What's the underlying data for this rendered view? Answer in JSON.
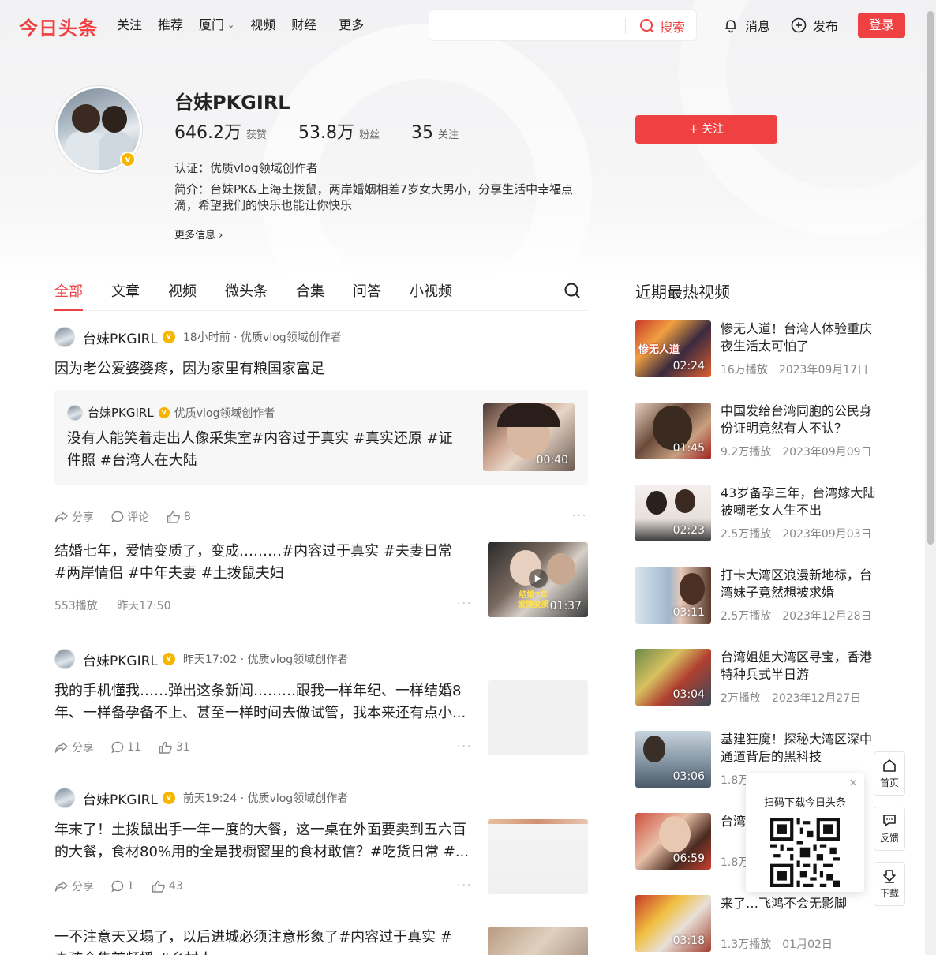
{
  "header": {
    "logo": "今日头条",
    "nav": [
      "关注",
      "推荐",
      "厦门",
      "视频",
      "财经",
      "更多"
    ],
    "search_placeholder": "",
    "search_label": "搜索",
    "messages": "消息",
    "publish": "发布",
    "login": "登录"
  },
  "profile": {
    "name": "台妹PKGIRL",
    "likes_num": "646.2万",
    "likes_label": "获赞",
    "fans_num": "53.8万",
    "fans_label": "粉丝",
    "following_num": "35",
    "following_label": "关注",
    "follow_button": "+ 关注",
    "certification": "认证：优质vlog领域创作者",
    "bio": "简介：台妹PK&上海土拨鼠，两岸婚姻相差7岁女大男小，分享生活中幸福点滴，希望我们的快乐也能让你快乐",
    "more_info": "更多信息"
  },
  "tabs": [
    "全部",
    "文章",
    "视频",
    "微头条",
    "合集",
    "问答",
    "小视频"
  ],
  "posts": [
    {
      "author": "台妹PKGIRL",
      "meta": "18小时前 · 优质vlog领域创作者",
      "text": "因为老公爱婆婆疼，因为家里有粮国家富足",
      "quote_author": "台妹PKGIRL",
      "quote_meta": "优质vlog领域创作者",
      "quote_text": "没有人能笑着走出人像采集室#内容过于真实 #真实还原 #证件照 #台湾人在大陆",
      "quote_duration": "00:40",
      "share": "分享",
      "comment": "评论",
      "likes": "8"
    },
    {
      "text": "结婚七年，爱情变质了，变成………#内容过于真实 #夫妻日常 #两岸情侣 #中年夫妻 #土拨鼠夫妇",
      "plays": "553播放",
      "time": "昨天17:50",
      "duration": "01:37",
      "thumb_caption": "结婚7年 爱情变质"
    },
    {
      "author": "台妹PKGIRL",
      "meta": "昨天17:02 · 优质vlog领域创作者",
      "text": "我的手机懂我……弹出这条新闻………跟我一样年纪、一样结婚8年、一样备孕备不上、甚至一样时间去做试管，我本来还有点小...",
      "share": "分享",
      "comments": "11",
      "likes": "31"
    },
    {
      "author": "台妹PKGIRL",
      "meta": "前天19:24 · 优质vlog领域创作者",
      "text": "年末了！土拨鼠出手一年一度的大餐，这一桌在外面要卖到五六百的大餐，食材80%用的全是我橱窗里的食材敢信？#吃货日常 #...",
      "share": "分享",
      "comments": "1",
      "likes": "43"
    },
    {
      "text": "一不注意天又塌了，以后进城必须注意形象了#内容过于真实 #真孩今隽首频播 #乡村人"
    }
  ],
  "sidebar": {
    "title": "近期最热视频",
    "items": [
      {
        "title": "惨无人道！台湾人体验重庆夜生活太可怕了",
        "plays": "16万播放",
        "date": "2023年09月17日",
        "duration": "02:24"
      },
      {
        "title": "中国发给台湾同胞的公民身份证明竟然有人不认？",
        "plays": "9.2万播放",
        "date": "2023年09月09日",
        "duration": "01:45"
      },
      {
        "title": "43岁备孕三年，台湾嫁大陆被嘲老女人生不出",
        "plays": "2.5万播放",
        "date": "2023年09月03日",
        "duration": "02:23"
      },
      {
        "title": "打卡大湾区浪漫新地标，台湾妹子竟然想被求婚",
        "plays": "2.5万播放",
        "date": "2023年12月28日",
        "duration": "03:11"
      },
      {
        "title": "台湾姐姐大湾区寻宝，香港特种兵式半日游",
        "plays": "2万播放",
        "date": "2023年12月27日",
        "duration": "03:04"
      },
      {
        "title": "基建狂魔！探秘大湾区深中通道背后的黑科技",
        "plays": "1.8万",
        "date": "",
        "duration": "03:06"
      },
      {
        "title": "台湾…于走…",
        "plays": "1.8万",
        "date": "",
        "duration": "06:59"
      },
      {
        "title": "来了…飞鸿不会无影脚",
        "plays": "1.3万播放",
        "date": "01月02日",
        "duration": "03:18"
      }
    ]
  },
  "float_tools": {
    "home": "首页",
    "feedback": "反馈",
    "download": "下载",
    "qr_title": "扫码下载今日头条",
    "qr_close": "×"
  }
}
